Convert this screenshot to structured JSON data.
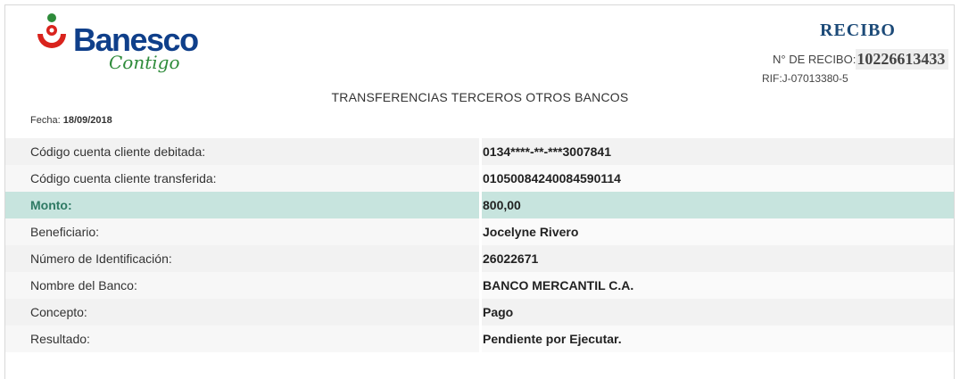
{
  "brand": {
    "name": "Banesco",
    "tagline": "Contigo"
  },
  "header": {
    "recibo_title": "RECIBO",
    "recibo_number_label": "N° DE RECIBO:",
    "recibo_number": "10226613433",
    "rif": "RIF:J-07013380-5",
    "page_title": "TRANSFERENCIAS TERCEROS OTROS BANCOS",
    "fecha_label": "Fecha:",
    "fecha_value": "18/09/2018"
  },
  "rows": [
    {
      "label": "Código cuenta cliente debitada:",
      "value": "0134****-**-***3007841"
    },
    {
      "label": "Código cuenta cliente transferida:",
      "value": "01050084240084590114"
    },
    {
      "label": "Monto:",
      "value": "800,00"
    },
    {
      "label": "Beneficiario:",
      "value": "Jocelyne Rivero"
    },
    {
      "label": "Número de Identificación:",
      "value": "26022671"
    },
    {
      "label": "Nombre del Banco:",
      "value": "BANCO MERCANTIL C.A."
    },
    {
      "label": "Concepto:",
      "value": "Pago"
    },
    {
      "label": "Resultado:",
      "value": "Pendiente por Ejecutar."
    }
  ],
  "colors": {
    "brand_blue": "#0f3f8a",
    "brand_green": "#2e8b3a",
    "brand_red": "#d9231d",
    "highlight_row": "#c7e4de"
  }
}
